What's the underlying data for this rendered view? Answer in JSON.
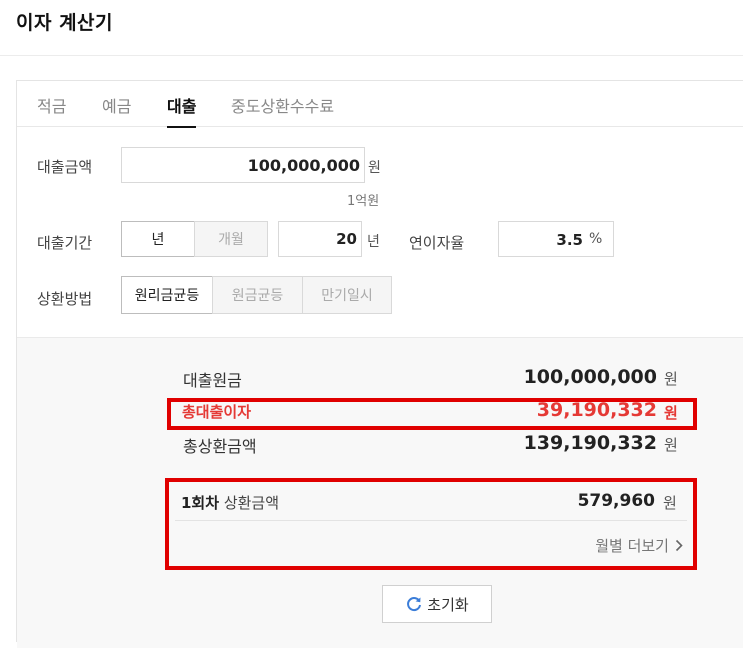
{
  "header": {
    "title": "이자 계산기"
  },
  "tabs": [
    {
      "label": "적금"
    },
    {
      "label": "예금"
    },
    {
      "label": "대출"
    },
    {
      "label": "중도상환수수료"
    }
  ],
  "form": {
    "amount": {
      "label": "대출금액",
      "value": "100,000,000",
      "unit": "원",
      "hint": "1억원"
    },
    "period": {
      "label": "대출기간",
      "unit_options": [
        "년",
        "개월"
      ],
      "selected_unit": "년",
      "value": "20",
      "unit": "년"
    },
    "rate": {
      "label": "연이자율",
      "value": "3.5",
      "unit": "%"
    },
    "method": {
      "label": "상환방법",
      "options": [
        "원리금균등",
        "원금균등",
        "만기일시"
      ],
      "selected": "원리금균등"
    }
  },
  "results": {
    "principal": {
      "label": "대출원금",
      "value": "100,000,000",
      "unit": "원"
    },
    "total_interest": {
      "label": "총대출이자",
      "value": "39,190,332",
      "unit": "원"
    },
    "total_repayment": {
      "label": "총상환금액",
      "value": "139,190,332",
      "unit": "원"
    },
    "installment": {
      "label_bold": "1회차",
      "label": "상환금액",
      "value": "579,960",
      "unit": "원",
      "more_link": "월별 더보기"
    }
  },
  "reset_label": "초기화",
  "colors": {
    "highlight": "#e00000",
    "interest_text": "#e53935",
    "refresh_icon": "#3b7dd8"
  }
}
